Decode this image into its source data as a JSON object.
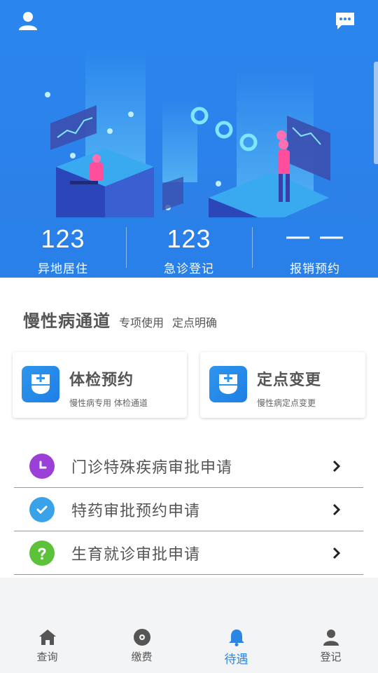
{
  "header": {
    "profile_icon": "user-icon",
    "message_icon": "chat-bubble-icon"
  },
  "stats": [
    {
      "value": "123",
      "label": "异地居住"
    },
    {
      "value": "123",
      "label": "急诊登记"
    },
    {
      "value": "一 一",
      "label": "报销预约"
    }
  ],
  "section": {
    "title": "慢性病通道",
    "subtitle_1": "专项使用",
    "subtitle_2": "定点明确"
  },
  "cards": [
    {
      "title": "体检预约",
      "desc": "慢性病专用  体检通道",
      "icon": "medical-cabinet-icon"
    },
    {
      "title": "定点变更",
      "desc": "慢性病定点变更",
      "icon": "medical-cabinet-icon"
    }
  ],
  "list": [
    {
      "label": "门诊特殊疾病审批申请",
      "icon": "clock-icon",
      "color": "#9b3fd6"
    },
    {
      "label": "特药审批预约申请",
      "icon": "check-icon",
      "color": "#3aa2e8"
    },
    {
      "label": "生育就诊审批申请",
      "icon": "question-icon",
      "color": "#5cc23a"
    }
  ],
  "tabs": [
    {
      "label": "查询",
      "icon": "home-icon"
    },
    {
      "label": "缴费",
      "icon": "disc-icon"
    },
    {
      "label": "待遇",
      "icon": "bell-icon",
      "active": true
    },
    {
      "label": "登记",
      "icon": "user-icon"
    }
  ],
  "colors": {
    "primary": "#2b85e4",
    "hero_bg": "#2a86ee"
  }
}
